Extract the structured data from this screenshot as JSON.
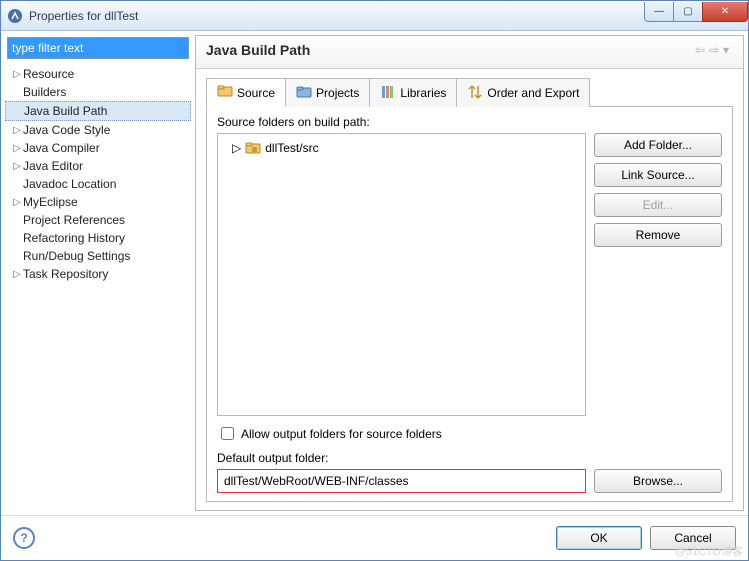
{
  "title": "Properties for dllTest",
  "filter_placeholder": "type filter text",
  "nav": {
    "items": [
      {
        "label": "Resource",
        "expandable": true
      },
      {
        "label": "Builders",
        "expandable": false
      },
      {
        "label": "Java Build Path",
        "expandable": false,
        "selected": true
      },
      {
        "label": "Java Code Style",
        "expandable": true
      },
      {
        "label": "Java Compiler",
        "expandable": true
      },
      {
        "label": "Java Editor",
        "expandable": true
      },
      {
        "label": "Javadoc Location",
        "expandable": false
      },
      {
        "label": "MyEclipse",
        "expandable": true
      },
      {
        "label": "Project References",
        "expandable": false
      },
      {
        "label": "Refactoring History",
        "expandable": false
      },
      {
        "label": "Run/Debug Settings",
        "expandable": false
      },
      {
        "label": "Task Repository",
        "expandable": true
      }
    ]
  },
  "page": {
    "heading": "Java Build Path",
    "tabs": [
      {
        "label": "Source",
        "active": true
      },
      {
        "label": "Projects"
      },
      {
        "label": "Libraries"
      },
      {
        "label": "Order and Export"
      }
    ],
    "source": {
      "label": "Source folders on build path:",
      "entries": [
        "dllTest/src"
      ],
      "buttons": {
        "add_folder": "Add Folder...",
        "link_source": "Link Source...",
        "edit": "Edit...",
        "remove": "Remove"
      },
      "allow_output_label": "Allow output folders for source folders",
      "default_output_label": "Default output folder:",
      "default_output_value": "dllTest/WebRoot/WEB-INF/classes",
      "browse": "Browse..."
    }
  },
  "footer": {
    "ok": "OK",
    "cancel": "Cancel"
  },
  "watermark": "@51CTO博客"
}
